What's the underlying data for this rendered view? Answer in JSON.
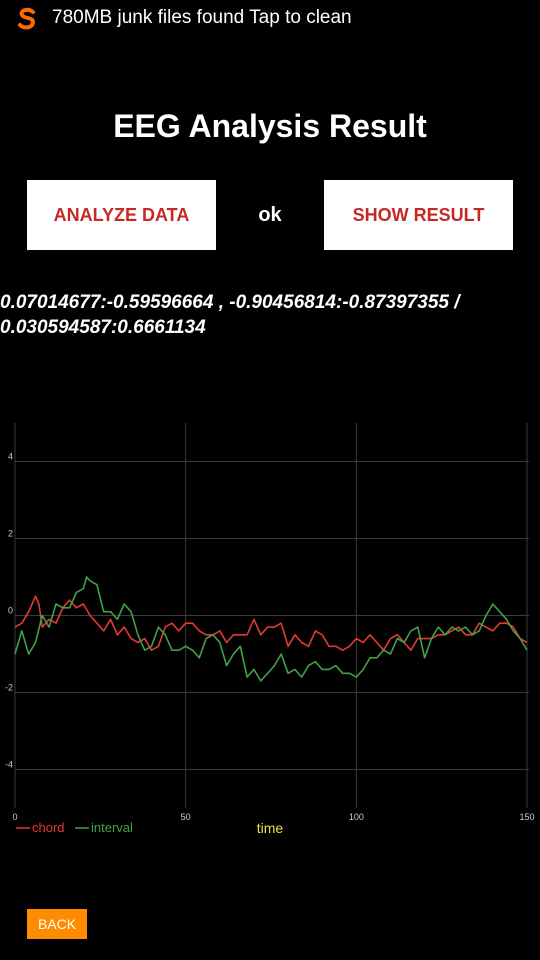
{
  "notification": {
    "message": "780MB junk files found Tap to clean",
    "icon": "app-logo-icon",
    "accent": "#ff6a00"
  },
  "page": {
    "title": "EEG Analysis Result",
    "analyze_label": "ANALYZE DATA",
    "status_text": "ok",
    "show_label": "SHOW RESULT",
    "readout_line1": "0.07014677:-0.59596664 , -0.90456814:-0.87397355 /",
    "readout_line2": "0.030594587:0.6661134",
    "back_label": "BACK",
    "back_color": "#ff8c00",
    "button_text_color": "#c62828"
  },
  "chart_data": {
    "type": "line",
    "xlabel": "time",
    "ylabel": "",
    "xlim": [
      0,
      150
    ],
    "ylim": [
      -5,
      5
    ],
    "x_ticks": [
      "0",
      "50",
      "100",
      "150"
    ],
    "y_ticks": [
      "4",
      "2",
      "0",
      "-2",
      "-4"
    ],
    "grid": true,
    "legend": "bottom-left",
    "series": [
      {
        "name": "chord",
        "color": "#e53935",
        "x": [
          0,
          2,
          4,
          6,
          7,
          8,
          10,
          12,
          14,
          16,
          18,
          20,
          22,
          24,
          26,
          28,
          30,
          32,
          34,
          36,
          38,
          40,
          42,
          44,
          46,
          48,
          50,
          52,
          54,
          56,
          58,
          60,
          62,
          64,
          66,
          68,
          70,
          72,
          74,
          76,
          78,
          80,
          82,
          84,
          86,
          88,
          90,
          92,
          94,
          96,
          98,
          100,
          102,
          104,
          106,
          108,
          110,
          112,
          114,
          116,
          118,
          120,
          122,
          124,
          126,
          128,
          130,
          132,
          134,
          136,
          138,
          140,
          142,
          144,
          146,
          148,
          150
        ],
        "y": [
          -0.3,
          -0.2,
          0.1,
          0.5,
          0.3,
          -0.3,
          -0.1,
          -0.2,
          0.2,
          0.4,
          0.2,
          0.3,
          0.0,
          -0.2,
          -0.4,
          -0.1,
          -0.5,
          -0.3,
          -0.6,
          -0.7,
          -0.6,
          -0.9,
          -0.8,
          -0.3,
          -0.2,
          -0.4,
          -0.2,
          -0.2,
          -0.4,
          -0.5,
          -0.5,
          -0.4,
          -0.7,
          -0.5,
          -0.5,
          -0.5,
          -0.1,
          -0.5,
          -0.3,
          -0.3,
          -0.2,
          -0.8,
          -0.5,
          -0.7,
          -0.8,
          -0.4,
          -0.5,
          -0.8,
          -0.8,
          -0.9,
          -0.8,
          -0.6,
          -0.7,
          -0.5,
          -0.7,
          -0.9,
          -0.6,
          -0.5,
          -0.7,
          -0.9,
          -0.6,
          -0.6,
          -0.6,
          -0.5,
          -0.5,
          -0.4,
          -0.3,
          -0.5,
          -0.5,
          -0.2,
          -0.3,
          -0.4,
          -0.2,
          -0.2,
          -0.3,
          -0.6,
          -0.7
        ]
      },
      {
        "name": "interval",
        "color": "#43a047",
        "x": [
          0,
          2,
          4,
          6,
          8,
          10,
          12,
          14,
          16,
          18,
          20,
          21,
          22,
          24,
          26,
          28,
          30,
          32,
          34,
          36,
          38,
          40,
          42,
          44,
          46,
          48,
          50,
          52,
          54,
          56,
          58,
          60,
          62,
          64,
          66,
          68,
          70,
          72,
          74,
          76,
          78,
          80,
          82,
          84,
          86,
          88,
          90,
          92,
          94,
          96,
          98,
          100,
          102,
          104,
          106,
          108,
          110,
          112,
          114,
          116,
          118,
          120,
          122,
          124,
          126,
          128,
          130,
          132,
          134,
          136,
          138,
          140,
          142,
          144,
          146,
          148,
          150
        ],
        "y": [
          -1.0,
          -0.4,
          -1.0,
          -0.7,
          0.0,
          -0.3,
          0.3,
          0.2,
          0.2,
          0.6,
          0.7,
          1.0,
          0.9,
          0.8,
          0.1,
          0.1,
          -0.1,
          0.3,
          0.1,
          -0.5,
          -0.9,
          -0.8,
          -0.3,
          -0.5,
          -0.9,
          -0.9,
          -0.8,
          -0.9,
          -1.1,
          -0.6,
          -0.5,
          -0.7,
          -1.3,
          -1.0,
          -0.8,
          -1.6,
          -1.4,
          -1.7,
          -1.5,
          -1.3,
          -1.0,
          -1.5,
          -1.4,
          -1.6,
          -1.3,
          -1.2,
          -1.4,
          -1.4,
          -1.3,
          -1.5,
          -1.5,
          -1.6,
          -1.4,
          -1.1,
          -1.1,
          -0.9,
          -1.0,
          -0.6,
          -0.7,
          -0.4,
          -0.3,
          -1.1,
          -0.6,
          -0.3,
          -0.5,
          -0.3,
          -0.4,
          -0.3,
          -0.5,
          -0.4,
          0.0,
          0.3,
          0.1,
          -0.1,
          -0.4,
          -0.6,
          -0.9
        ]
      }
    ]
  }
}
